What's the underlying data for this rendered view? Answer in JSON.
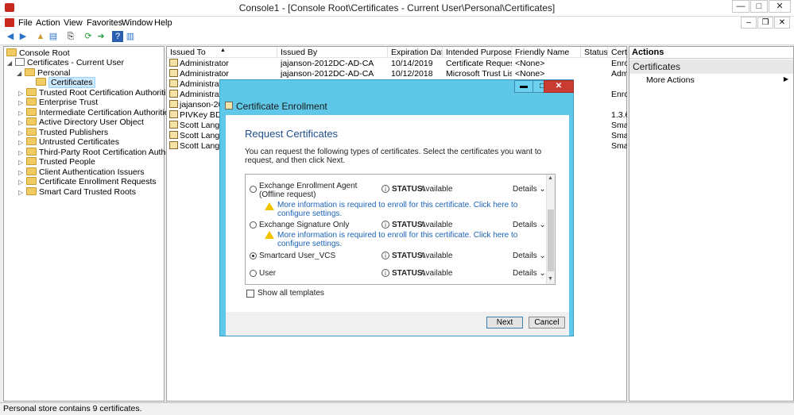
{
  "window": {
    "title": "Console1 - [Console Root\\Certificates - Current User\\Personal\\Certificates]",
    "btn_min": "—",
    "btn_max": "□",
    "btn_close": "✕"
  },
  "menubar": {
    "items": [
      "File",
      "Action",
      "View",
      "Favorites",
      "Window",
      "Help"
    ],
    "btn_min": "–",
    "btn_restore": "❐",
    "btn_close": "✕"
  },
  "toolbar": {
    "back": "◀",
    "forward": "▶",
    "up": "▲",
    "view": "▤",
    "copy": "⎘",
    "refresh": "⟳",
    "export": "➜",
    "help": "?",
    "showhide": "▥"
  },
  "tree": {
    "root": "Console Root",
    "certs_current_user": "Certificates - Current User",
    "personal": "Personal",
    "certificates": "Certificates",
    "children": [
      "Trusted Root Certification Authorities",
      "Enterprise Trust",
      "Intermediate Certification Authorities",
      "Active Directory User Object",
      "Trusted Publishers",
      "Untrusted Certificates",
      "Third-Party Root Certification Authorities",
      "Trusted People",
      "Client Authentication Issuers",
      "Certificate Enrollment Requests",
      "Smart Card Trusted Roots"
    ]
  },
  "list": {
    "headers": [
      "Issued To",
      "Issued By",
      "Expiration Date",
      "Intended Purposes",
      "Friendly Name",
      "Status",
      "Certi"
    ],
    "rows": [
      [
        "Administrator",
        "jajanson-2012DC-AD-CA",
        "10/14/2019",
        "Certificate Request ...",
        "<None>",
        "",
        "Enro"
      ],
      [
        "Administrator",
        "jajanson-2012DC-AD-CA",
        "10/12/2018",
        "Microsoft Trust List...",
        "<None>",
        "",
        "Adm"
      ],
      [
        "Administrator",
        "",
        "",
        "",
        "",
        "",
        ""
      ],
      [
        "Administrator",
        "",
        "",
        "",
        "",
        "",
        "Enro"
      ],
      [
        "jajanson-2012",
        "",
        "",
        "",
        "",
        "",
        ""
      ],
      [
        "PIVKey BD9A5",
        "",
        "",
        "",
        "",
        "",
        "1.3.6"
      ],
      [
        "Scott Lang",
        "",
        "",
        "",
        "",
        "",
        "Sma"
      ],
      [
        "Scott Lang",
        "",
        "",
        "",
        "",
        "",
        "Sma"
      ],
      [
        "Scott Lang",
        "",
        "",
        "",
        "",
        "",
        "Sma"
      ]
    ]
  },
  "actions": {
    "header": "Actions",
    "section": "Certificates",
    "more": "More Actions"
  },
  "statusbar": "Personal store contains 9 certificates.",
  "dialog": {
    "title": "Certificate Enrollment",
    "heading": "Request Certificates",
    "description": "You can request the following types of certificates. Select the certificates you want to request, and then click Next.",
    "status_label": "STATUS:",
    "details_label": "Details ⌄",
    "items": [
      {
        "name": "Exchange Enrollment Agent (Offline request)",
        "status": "Available",
        "warning": "More information is required to enroll for this certificate. Click here to configure settings.",
        "selected": false
      },
      {
        "name": "Exchange Signature Only",
        "status": "Available",
        "warning": "More information is required to enroll for this certificate. Click here to configure settings.",
        "selected": false
      },
      {
        "name": "Smartcard User_VCS",
        "status": "Available",
        "warning": "",
        "selected": true
      },
      {
        "name": "User",
        "status": "Available",
        "warning": "",
        "selected": false
      }
    ],
    "show_all": "Show all templates",
    "next": "Next",
    "cancel": "Cancel",
    "btn_min": "▬",
    "btn_max": "□",
    "btn_close": "✕"
  }
}
